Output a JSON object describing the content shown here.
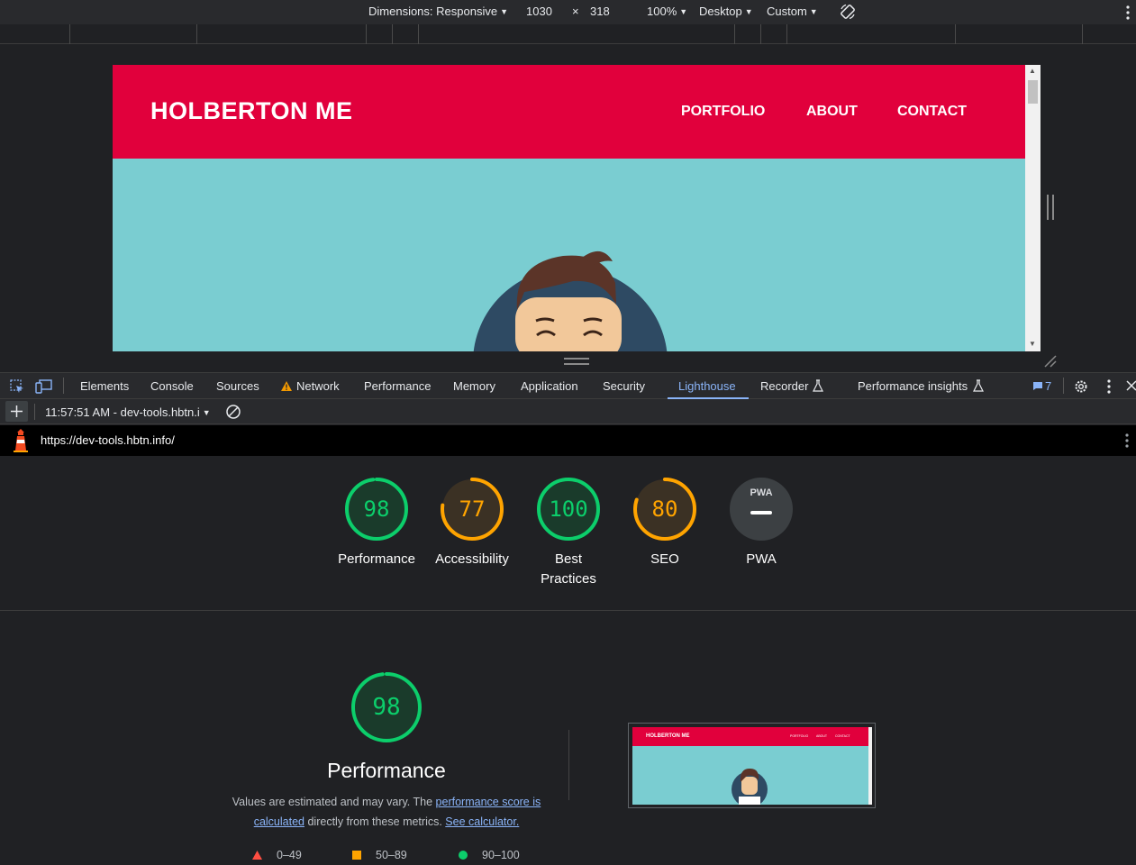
{
  "device_toolbar": {
    "dimensions_label": "Dimensions: Responsive",
    "width": "1030",
    "times": "×",
    "height": "318",
    "zoom": "100%",
    "device_type": "Desktop",
    "throttle": "Custom"
  },
  "site": {
    "title": "HOLBERTON ME",
    "nav": [
      "PORTFOLIO",
      "ABOUT",
      "CONTACT"
    ],
    "colors": {
      "header": "#e1003c",
      "body": "#7acdd1"
    }
  },
  "devtools_tabs": [
    "Elements",
    "Console",
    "Sources",
    "Network",
    "Performance",
    "Memory",
    "Application",
    "Security",
    "Lighthouse",
    "Recorder",
    "Performance insights"
  ],
  "active_tab": "Lighthouse",
  "issues_count": "7",
  "lighthouse": {
    "report_selector": "11:57:51 AM - dev-tools.hbtn.i",
    "url": "https://dev-tools.hbtn.info/",
    "scores": [
      {
        "value": "98",
        "label": "Performance",
        "score": 0.98,
        "color": "#0cce6b"
      },
      {
        "value": "77",
        "label": "Accessibility",
        "score": 0.77,
        "color": "#ffa400"
      },
      {
        "value": "100",
        "label": "Best Practices",
        "score": 1.0,
        "color": "#0cce6b"
      },
      {
        "value": "80",
        "label": "SEO",
        "score": 0.8,
        "color": "#ffa400"
      },
      {
        "value": "PWA",
        "label": "PWA",
        "score": null,
        "color": "#9aa0a6"
      }
    ],
    "performance": {
      "score": "98",
      "title": "Performance",
      "desc_prefix": "Values are estimated and may vary. The ",
      "link1": "performance score is calculated",
      "desc_mid": " directly from these metrics. ",
      "link2": "See calculator."
    },
    "legend": [
      "0–49",
      "50–89",
      "90–100"
    ],
    "thumbnail": {
      "title": "HOLBERTON ME",
      "nav": [
        "PORTFOLIO",
        "ABOUT",
        "CONTACT"
      ]
    }
  }
}
